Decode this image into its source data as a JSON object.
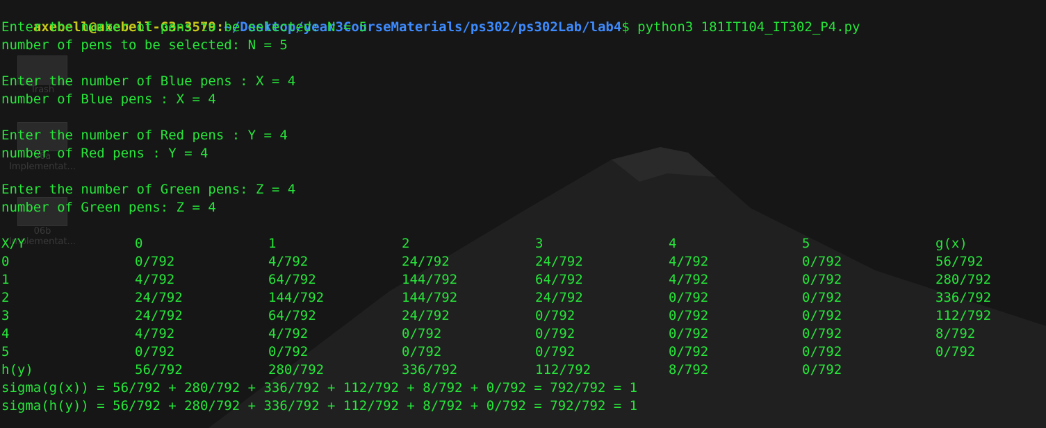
{
  "prompt": {
    "user_host": "axebell@axebell-G3-3579",
    "separator": ":",
    "path": "~/Desktop/year3CourseMaterials/ps302/ps302Lab/lab4",
    "symbol": "$",
    "command": " python3 181IT104_IT302_P4.py"
  },
  "desktop_icons": [
    "Trash",
    "06a Implementat...",
    "06b Implementat..."
  ],
  "output_lines": [
    "Enter the number of pens to be selected: N = 5",
    "number of pens to be selected: N = 5",
    "",
    "Enter the number of Blue pens : X = 4",
    "number of Blue pens : X = 4",
    "",
    "Enter the number of Red pens : Y = 4",
    "number of Red pens : Y = 4",
    "",
    "Enter the number of Green pens: Z = 4",
    "number of Green pens: Z = 4"
  ],
  "table": {
    "header": [
      "X/Y",
      "0",
      "1",
      "2",
      "3",
      "4",
      "5",
      "g(x)"
    ],
    "rows": [
      [
        "0",
        "0/792",
        "4/792",
        "24/792",
        "24/792",
        "4/792",
        "0/792",
        "56/792"
      ],
      [
        "1",
        "4/792",
        "64/792",
        "144/792",
        "64/792",
        "4/792",
        "0/792",
        "280/792"
      ],
      [
        "2",
        "24/792",
        "144/792",
        "144/792",
        "24/792",
        "0/792",
        "0/792",
        "336/792"
      ],
      [
        "3",
        "24/792",
        "64/792",
        "24/792",
        "0/792",
        "0/792",
        "0/792",
        "112/792"
      ],
      [
        "4",
        "4/792",
        "4/792",
        "0/792",
        "0/792",
        "0/792",
        "0/792",
        "8/792"
      ],
      [
        "5",
        "0/792",
        "0/792",
        "0/792",
        "0/792",
        "0/792",
        "0/792",
        "0/792"
      ],
      [
        "h(y)",
        "56/792",
        "280/792",
        "336/792",
        "112/792",
        "8/792",
        "0/792",
        ""
      ]
    ]
  },
  "sigma_lines": [
    "sigma(g(x)) = 56/792 + 280/792 + 336/792 + 112/792 + 8/792 + 0/792 = 792/792 = 1",
    "sigma(h(y)) = 56/792 + 280/792 + 336/792 + 112/792 + 8/792 + 0/792 = 792/792 = 1"
  ],
  "colors": {
    "background": "#161616",
    "output_green": "#27e53a",
    "prompt_user": "#c9c91a",
    "prompt_path": "#3d8bff"
  }
}
